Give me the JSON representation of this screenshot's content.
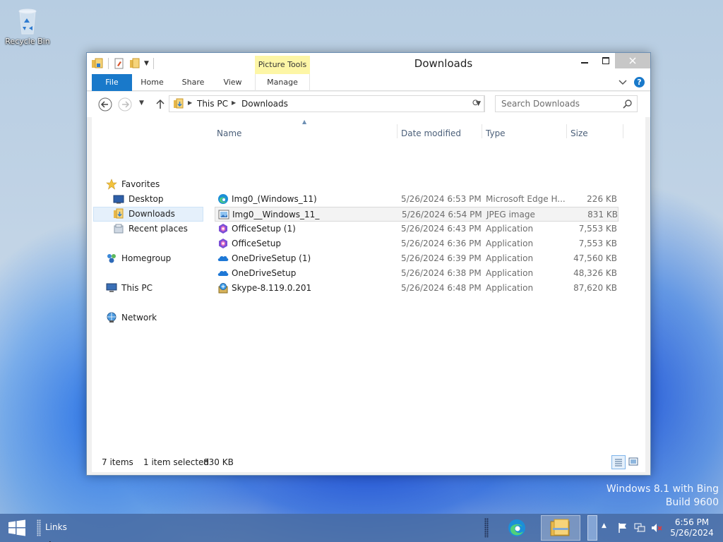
{
  "desktop": {
    "recycle_bin_label": "Recycle Bin",
    "watermark_line1": "Windows 8.1 with Bing",
    "watermark_line2": "Build 9600"
  },
  "window": {
    "title": "Downloads",
    "context_tab_group": "Picture Tools",
    "ribbon_tabs": {
      "file": "File",
      "home": "Home",
      "share": "Share",
      "view": "View",
      "manage": "Manage"
    },
    "help_label": "?"
  },
  "address_bar": {
    "crumbs": [
      "This PC",
      "Downloads"
    ],
    "search_placeholder": "Search Downloads"
  },
  "nav_pane": {
    "favorites": "Favorites",
    "desktop": "Desktop",
    "downloads": "Downloads",
    "recent": "Recent places",
    "homegroup": "Homegroup",
    "this_pc": "This PC",
    "network": "Network"
  },
  "columns": {
    "name": "Name",
    "date": "Date modified",
    "type": "Type",
    "size": "Size"
  },
  "files": [
    {
      "name": "Img0_(Windows_11)",
      "date": "5/26/2024 6:53 PM",
      "type": "Microsoft Edge H...",
      "size": "226 KB",
      "icon": "edge-icon"
    },
    {
      "name": "Img0__Windows_11_",
      "date": "5/26/2024 6:54 PM",
      "type": "JPEG image",
      "size": "831 KB",
      "icon": "image-icon"
    },
    {
      "name": "OfficeSetup (1)",
      "date": "5/26/2024 6:43 PM",
      "type": "Application",
      "size": "7,553 KB",
      "icon": "office-icon"
    },
    {
      "name": "OfficeSetup",
      "date": "5/26/2024 6:36 PM",
      "type": "Application",
      "size": "7,553 KB",
      "icon": "office-icon"
    },
    {
      "name": "OneDriveSetup (1)",
      "date": "5/26/2024 6:39 PM",
      "type": "Application",
      "size": "47,560 KB",
      "icon": "onedrive-icon"
    },
    {
      "name": "OneDriveSetup",
      "date": "5/26/2024 6:38 PM",
      "type": "Application",
      "size": "48,326 KB",
      "icon": "onedrive-icon"
    },
    {
      "name": "Skype-8.119.0.201",
      "date": "5/26/2024 6:48 PM",
      "type": "Application",
      "size": "87,620 KB",
      "icon": "setup-icon"
    }
  ],
  "status": {
    "item_count": "7 items",
    "selection": "1 item selected",
    "selection_size": "830 KB"
  },
  "taskbar": {
    "links_label": "Links",
    "time": "6:56 PM",
    "date": "5/26/2024"
  },
  "colors": {
    "accent": "#1979ca",
    "context_tab": "#fdf6a6",
    "selection_bg": "#e5f0fb"
  }
}
